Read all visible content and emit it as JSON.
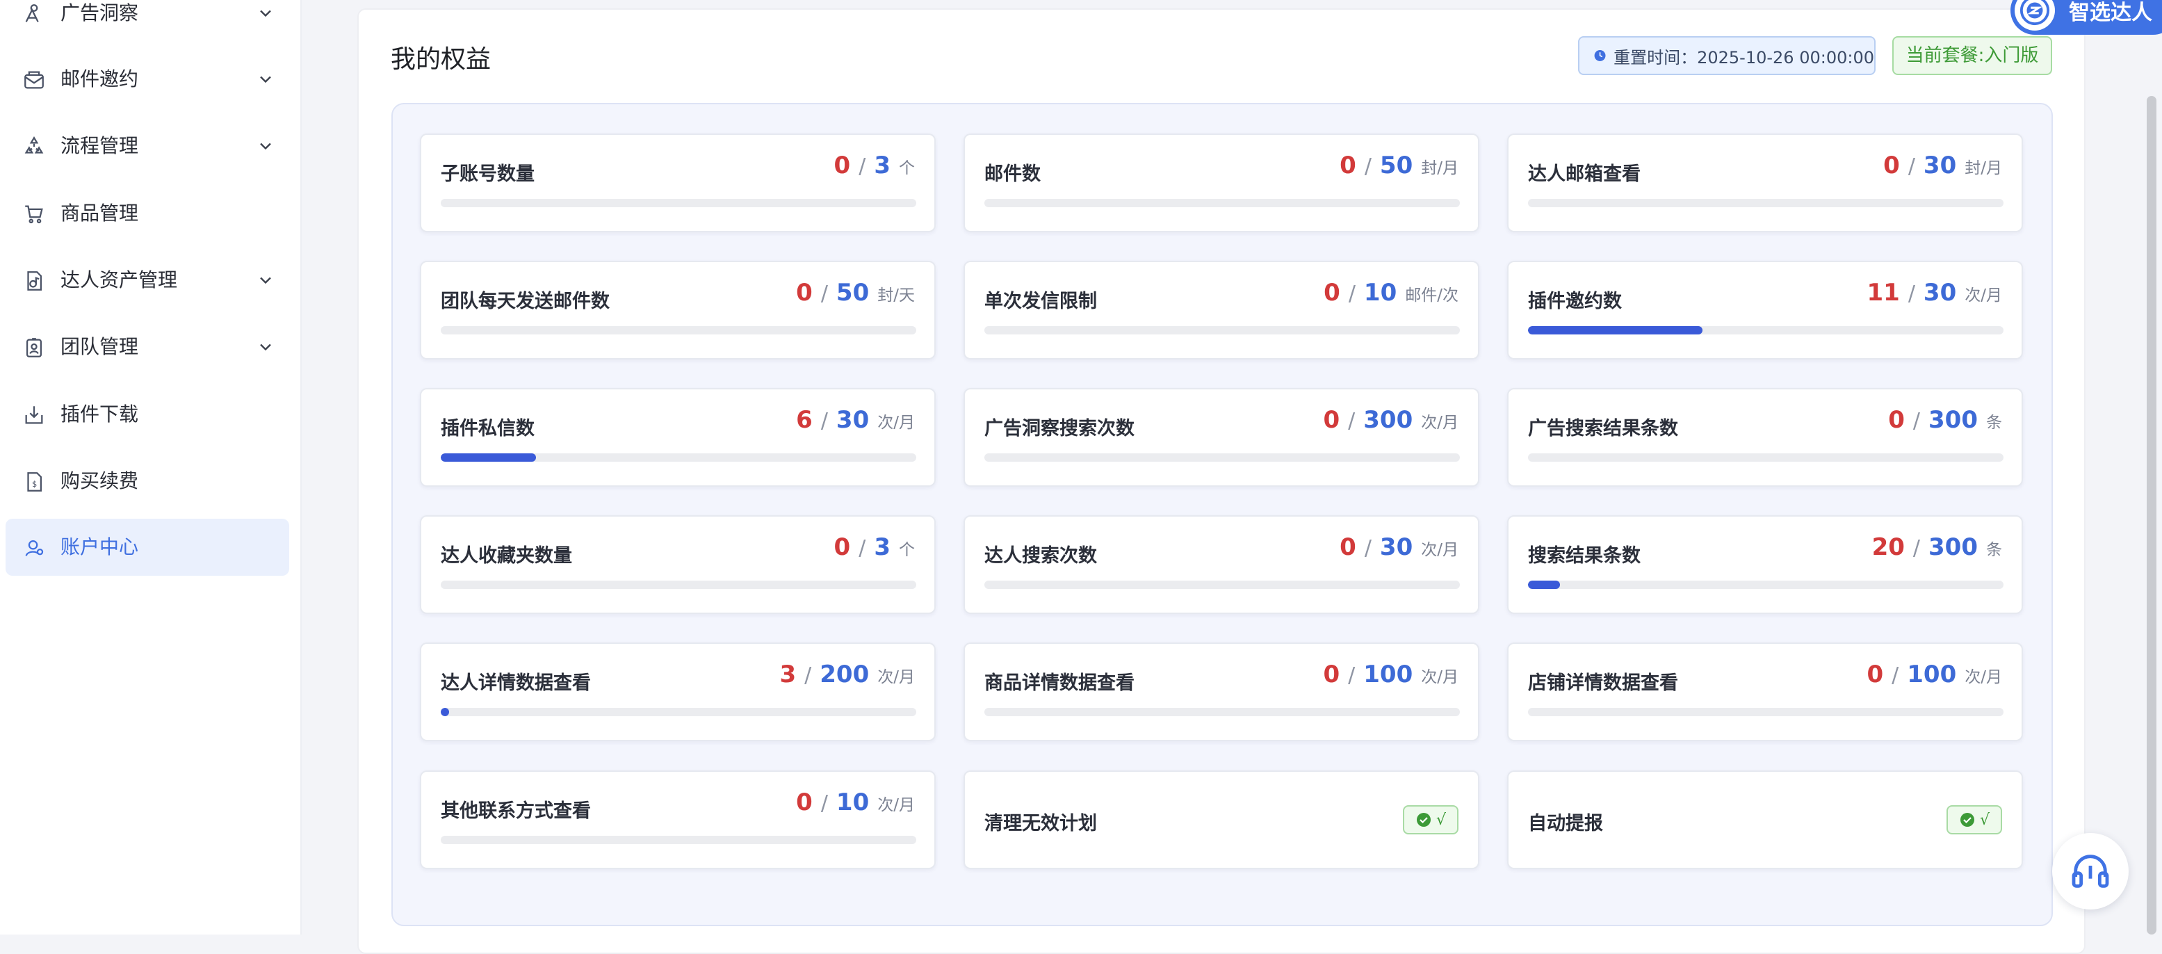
{
  "sidebar": {
    "items": [
      {
        "label": "广告洞察",
        "icon": "ad-insight-icon",
        "has_chevron": true
      },
      {
        "label": "邮件邀约",
        "icon": "mail-icon",
        "has_chevron": true
      },
      {
        "label": "流程管理",
        "icon": "process-icon",
        "has_chevron": true
      },
      {
        "label": "商品管理",
        "icon": "cart-icon",
        "has_chevron": false
      },
      {
        "label": "达人资产管理",
        "icon": "asset-icon",
        "has_chevron": true
      },
      {
        "label": "团队管理",
        "icon": "team-icon",
        "has_chevron": true
      },
      {
        "label": "插件下载",
        "icon": "download-icon",
        "has_chevron": false
      },
      {
        "label": "购买续费",
        "icon": "purchase-icon",
        "has_chevron": false
      },
      {
        "label": "账户中心",
        "icon": "account-icon",
        "has_chevron": false,
        "active": true
      }
    ]
  },
  "main": {
    "title": "我的权益",
    "reset_time": "重置时间：2025-10-26 00:00:00",
    "plan": "当前套餐:入门版"
  },
  "stats": [
    {
      "label": "子账号数量",
      "used": "0",
      "total": "3",
      "unit": "个",
      "progress": 0
    },
    {
      "label": "邮件数",
      "used": "0",
      "total": "50",
      "unit": "封/月",
      "progress": 0
    },
    {
      "label": "达人邮箱查看",
      "used": "0",
      "total": "30",
      "unit": "封/月",
      "progress": 0
    },
    {
      "label": "团队每天发送邮件数",
      "used": "0",
      "total": "50",
      "unit": "封/天",
      "progress": 0
    },
    {
      "label": "单次发信限制",
      "used": "0",
      "total": "10",
      "unit": "邮件/次",
      "progress": 0
    },
    {
      "label": "插件邀约数",
      "used": "11",
      "total": "30",
      "unit": "次/月",
      "progress": 0.3667
    },
    {
      "label": "插件私信数",
      "used": "6",
      "total": "30",
      "unit": "次/月",
      "progress": 0.2
    },
    {
      "label": "广告洞察搜索次数",
      "used": "0",
      "total": "300",
      "unit": "次/月",
      "progress": 0
    },
    {
      "label": "广告搜索结果条数",
      "used": "0",
      "total": "300",
      "unit": "条",
      "progress": 0
    },
    {
      "label": "达人收藏夹数量",
      "used": "0",
      "total": "3",
      "unit": "个",
      "progress": 0
    },
    {
      "label": "达人搜索次数",
      "used": "0",
      "total": "30",
      "unit": "次/月",
      "progress": 0
    },
    {
      "label": "搜索结果条数",
      "used": "20",
      "total": "300",
      "unit": "条",
      "progress": 0.0667
    },
    {
      "label": "达人详情数据查看",
      "used": "3",
      "total": "200",
      "unit": "次/月",
      "progress": 0.015
    },
    {
      "label": "商品详情数据查看",
      "used": "0",
      "total": "100",
      "unit": "次/月",
      "progress": 0
    },
    {
      "label": "店铺详情数据查看",
      "used": "0",
      "total": "100",
      "unit": "次/月",
      "progress": 0
    },
    {
      "label": "其他联系方式查看",
      "used": "0",
      "total": "10",
      "unit": "次/月",
      "progress": 0
    }
  ],
  "toggles": [
    {
      "label": "清理无效计划",
      "value": "√"
    },
    {
      "label": "自动提报",
      "value": "√"
    }
  ],
  "brand": {
    "text": "智选达人",
    "color": "#3f72e4"
  },
  "colors": {
    "used": "#d23a3a",
    "total": "#3d6ad6",
    "progress_fill": "#3a5ad8",
    "active_nav_bg": "#eaf0fd"
  }
}
